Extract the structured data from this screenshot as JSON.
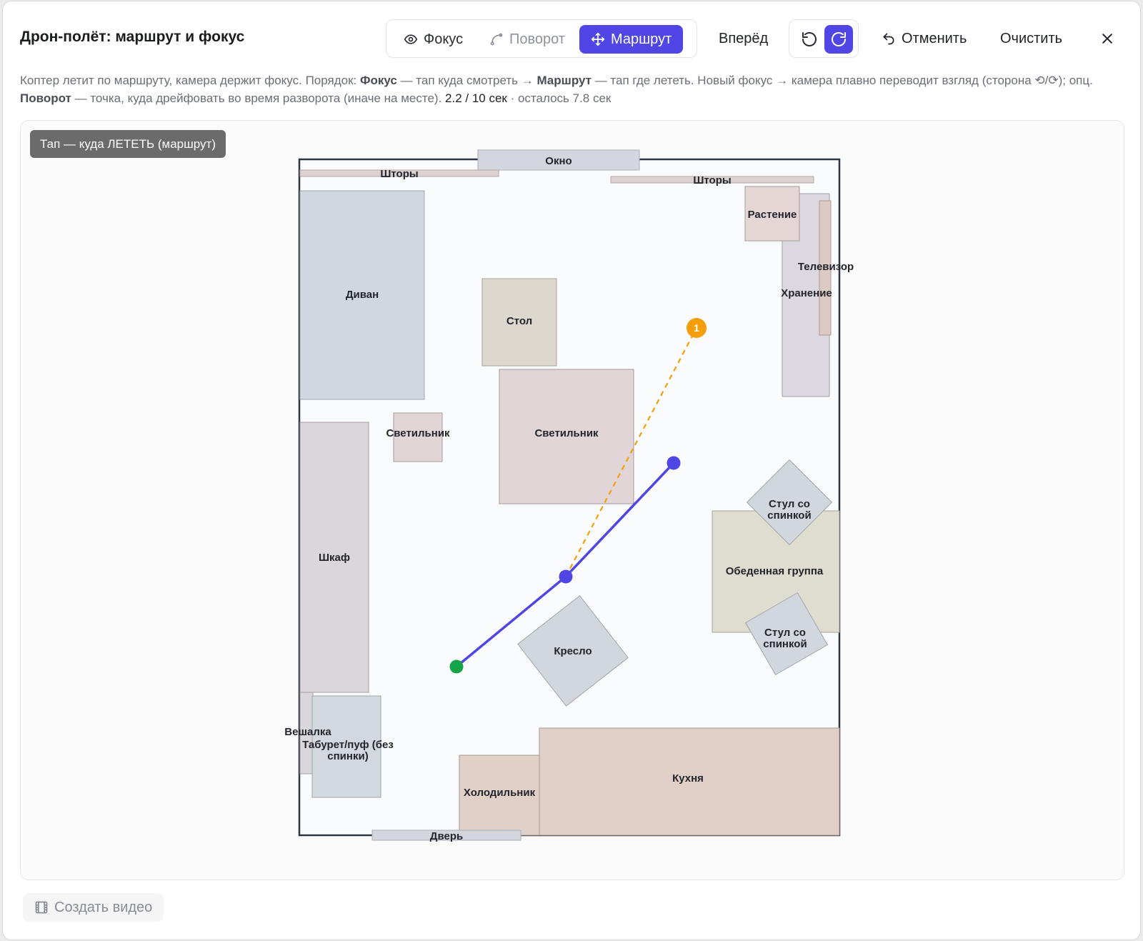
{
  "header": {
    "title": "Дрон-полёт: маршрут и фокус",
    "modes": [
      {
        "label": "Фокус",
        "icon": "eye-icon",
        "state": "normal"
      },
      {
        "label": "Поворот",
        "icon": "curve-path-icon",
        "state": "disabled"
      },
      {
        "label": "Маршрут",
        "icon": "move-arrows-icon",
        "state": "active"
      }
    ],
    "forward_label": "Вперёд",
    "rotate_ccw_icon": "rotate-ccw-icon",
    "rotate_cw_icon": "rotate-cw-icon",
    "undo_label": "Отменить",
    "clear_label": "Очистить",
    "close_icon": "close-icon"
  },
  "description": {
    "p1": "Коптер летит по маршруту, камера держит фокус. Порядок: ",
    "focus_word": "Фокус",
    "p2": " — тап куда смотреть → ",
    "route_word": "Маршрут",
    "p3": " — тап где лететь. Новый фокус → камера плавно переводит взгляд (сторона ⟲/⟳); опц. ",
    "turn_word": "Поворот",
    "p4": " — точка, куда дрейфовать во время разворота (иначе на месте). ",
    "time": "2.2 / 10 сек",
    "remaining": " · осталось 7.8 сек"
  },
  "canvas": {
    "hint": "Тап — куда ЛЕТЕТЬ (маршрут)",
    "objects": {
      "window": "Окно",
      "curtains_left": "Шторы",
      "curtains_right": "Шторы",
      "plant": "Растение",
      "tv": "Телевизор",
      "storage": "Хранение",
      "sofa": "Диван",
      "table": "Стол",
      "lamp_small": "Светильник",
      "lamp_large": "Светильник",
      "chair_top_1": "Стул со",
      "chair_top_2": "спинкой",
      "dining": "Обеденная группа",
      "chair_bottom_1": "Стул со",
      "chair_bottom_2": "спинкой",
      "wardrobe": "Шкаф",
      "armchair": "Кресло",
      "hanger": "Вешалка",
      "stool_1": "Табурет/пуф (без",
      "stool_2": "спинки)",
      "fridge": "Холодильник",
      "kitchen": "Кухня",
      "door": "Дверь"
    },
    "focus_marker": "1",
    "colors": {
      "route": "#4f46e5",
      "start": "#16a34a",
      "focus": "#f59e0b"
    }
  },
  "footer": {
    "create_video_label": "Создать видео",
    "icon": "film-icon"
  }
}
